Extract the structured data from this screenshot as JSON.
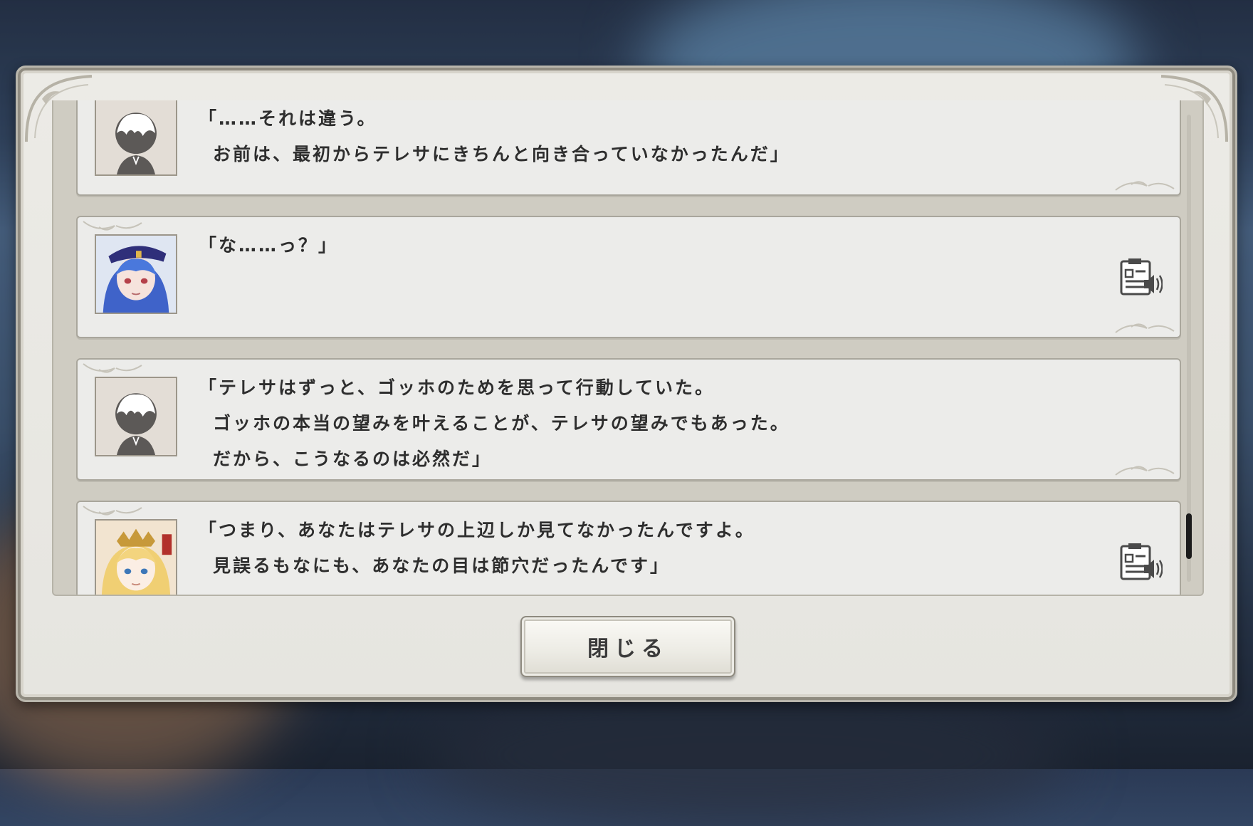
{
  "dialog": {
    "title": "",
    "close_label": "閉じる"
  },
  "log_entries": [
    {
      "speaker_icon": "silhouette-avatar-icon",
      "lines": [
        "「……それは違う。",
        "お前は、最初からテレサにきちんと向き合っていなかったんだ」"
      ],
      "has_voice": false
    },
    {
      "speaker_icon": "blue-haired-girl-portrait",
      "lines": [
        "「な……っ？」"
      ],
      "has_voice": true
    },
    {
      "speaker_icon": "silhouette-avatar-icon",
      "lines": [
        "「テレサはずっと、ゴッホのためを思って行動していた。",
        "ゴッホの本当の望みを叶えることが、テレサの望みでもあった。",
        "だから、こうなるのは必然だ」"
      ],
      "has_voice": false
    },
    {
      "speaker_icon": "blonde-girl-portrait",
      "lines": [
        "「つまり、あなたはテレサの上辺しか見てなかったんですよ。",
        "見誤るもなにも、あなたの目は節穴だったんです」"
      ],
      "has_voice": true
    }
  ],
  "icons": {
    "voice": "voice-replay-icon"
  },
  "colors": {
    "panel": "#e6e5e0",
    "entry": "#ececea",
    "text": "#2e2e2e",
    "scroll_thumb": "#1b1b1b"
  }
}
